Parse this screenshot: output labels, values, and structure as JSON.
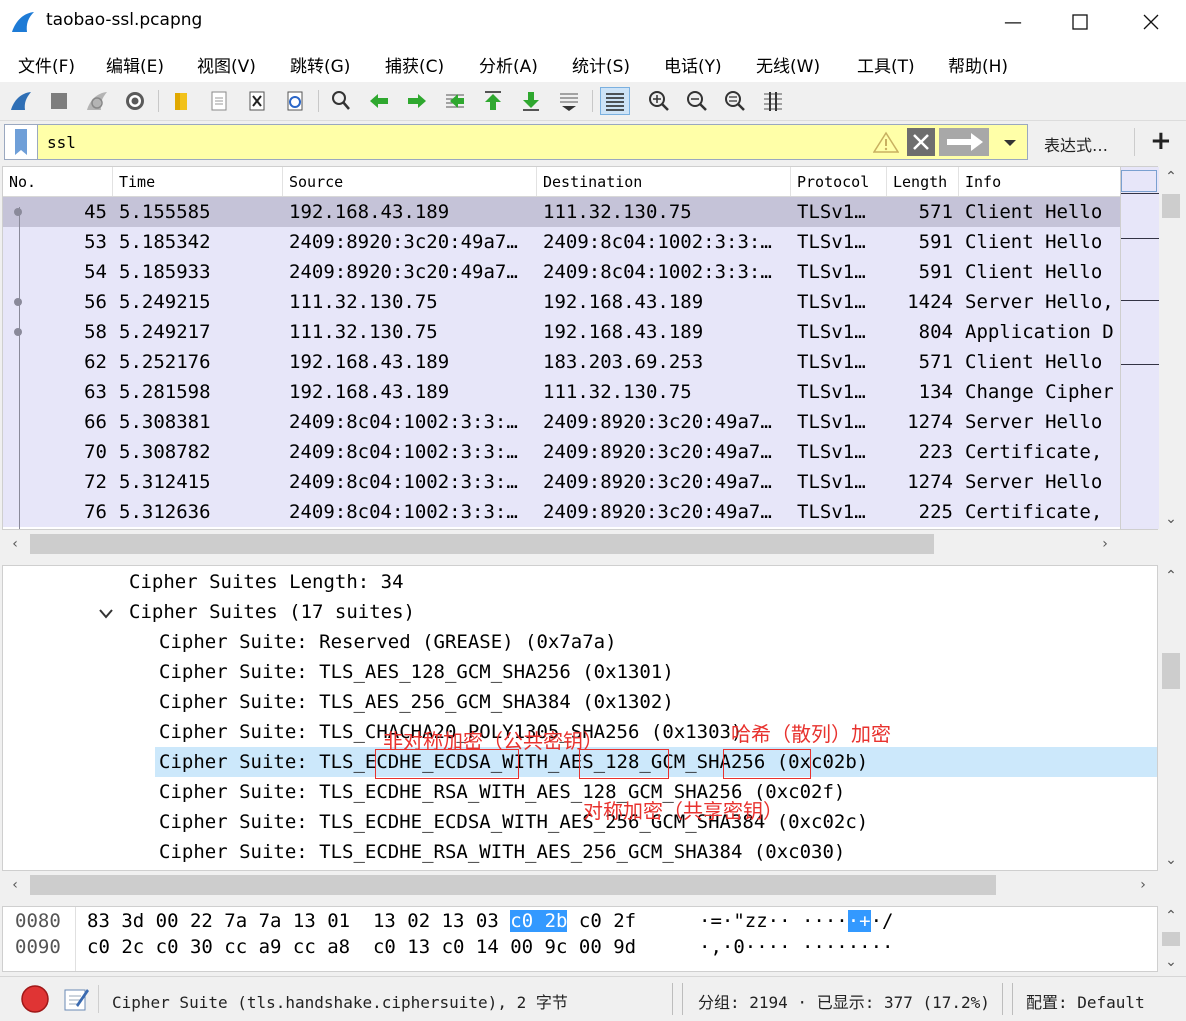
{
  "window": {
    "title": "taobao-ssl.pcapng",
    "min_icon": "minimize-icon",
    "max_icon": "maximize-icon",
    "close_icon": "close-icon"
  },
  "menu": [
    "文件(F)",
    "编辑(E)",
    "视图(V)",
    "跳转(G)",
    "捕获(C)",
    "分析(A)",
    "统计(S)",
    "电话(Y)",
    "无线(W)",
    "工具(T)",
    "帮助(H)"
  ],
  "filter": {
    "value": "ssl",
    "expression_label": "表达式…",
    "add_label": "+"
  },
  "packet_list": {
    "columns": [
      "No.",
      "Time",
      "Source",
      "Destination",
      "Protocol",
      "Length",
      "Info"
    ],
    "rows": [
      {
        "no": "45",
        "time": "5.155585",
        "src": "192.168.43.189",
        "dst": "111.32.130.75",
        "proto": "TLSv1…",
        "len": "571",
        "info": "Client Hello"
      },
      {
        "no": "53",
        "time": "5.185342",
        "src": "2409:8920:3c20:49a7…",
        "dst": "2409:8c04:1002:3:3:…",
        "proto": "TLSv1…",
        "len": "591",
        "info": "Client Hello"
      },
      {
        "no": "54",
        "time": "5.185933",
        "src": "2409:8920:3c20:49a7…",
        "dst": "2409:8c04:1002:3:3:…",
        "proto": "TLSv1…",
        "len": "591",
        "info": "Client Hello"
      },
      {
        "no": "56",
        "time": "5.249215",
        "src": "111.32.130.75",
        "dst": "192.168.43.189",
        "proto": "TLSv1…",
        "len": "1424",
        "info": "Server Hello,"
      },
      {
        "no": "58",
        "time": "5.249217",
        "src": "111.32.130.75",
        "dst": "192.168.43.189",
        "proto": "TLSv1…",
        "len": "804",
        "info": "Application D"
      },
      {
        "no": "62",
        "time": "5.252176",
        "src": "192.168.43.189",
        "dst": "183.203.69.253",
        "proto": "TLSv1…",
        "len": "571",
        "info": "Client Hello"
      },
      {
        "no": "63",
        "time": "5.281598",
        "src": "192.168.43.189",
        "dst": "111.32.130.75",
        "proto": "TLSv1…",
        "len": "134",
        "info": "Change Cipher"
      },
      {
        "no": "66",
        "time": "5.308381",
        "src": "2409:8c04:1002:3:3:…",
        "dst": "2409:8920:3c20:49a7…",
        "proto": "TLSv1…",
        "len": "1274",
        "info": "Server Hello"
      },
      {
        "no": "70",
        "time": "5.308782",
        "src": "2409:8c04:1002:3:3:…",
        "dst": "2409:8920:3c20:49a7…",
        "proto": "TLSv1…",
        "len": "223",
        "info": "Certificate,"
      },
      {
        "no": "72",
        "time": "5.312415",
        "src": "2409:8c04:1002:3:3:…",
        "dst": "2409:8920:3c20:49a7…",
        "proto": "TLSv1…",
        "len": "1274",
        "info": "Server Hello"
      },
      {
        "no": "76",
        "time": "5.312636",
        "src": "2409:8c04:1002:3:3:…",
        "dst": "2409:8920:3c20:49a7…",
        "proto": "TLSv1…",
        "len": "225",
        "info": "Certificate,"
      }
    ]
  },
  "details": {
    "lines": [
      "Cipher Suites Length: 34",
      "Cipher Suites (17 suites)",
      "Cipher Suite: Reserved (GREASE) (0x7a7a)",
      "Cipher Suite: TLS_AES_128_GCM_SHA256 (0x1301)",
      "Cipher Suite: TLS_AES_256_GCM_SHA384 (0x1302)",
      "Cipher Suite: TLS_CHACHA20_POLY1305_SHA256 (0x1303)",
      "Cipher Suite: TLS_ECDHE_ECDSA_WITH_AES_128_GCM_SHA256 (0xc02b)",
      "Cipher Suite: TLS_ECDHE_RSA_WITH_AES_128_GCM_SHA256 (0xc02f)",
      "Cipher Suite: TLS_ECDHE_ECDSA_WITH_AES_256_GCM_SHA384 (0xc02c)",
      "Cipher Suite: TLS_ECDHE_RSA_WITH_AES_256_GCM_SHA384 (0xc030)"
    ],
    "annotations": {
      "asymmetric": "非对称加密（公共密钥）",
      "hash": "哈希（散列）加密",
      "symmetric": "对称加密（共享密钥）"
    }
  },
  "bytes": {
    "rows": [
      {
        "offset": "0080",
        "hex_a": "83 3d 00 22 7a 7a 13 01  13 02 13 03 ",
        "hex_sel": "c0 2b",
        "hex_b": " c0 2f",
        "ascii_a": "·=·\"zz·· ····",
        "ascii_sel": "·+",
        "ascii_b": "·/"
      },
      {
        "offset": "0090",
        "hex_a": "c0 2c c0 30 cc a9 cc a8  c0 13 c0 14 00 9c 00 9d",
        "hex_sel": "",
        "hex_b": "",
        "ascii_a": "·,·0···· ········",
        "ascii_sel": "",
        "ascii_b": ""
      }
    ]
  },
  "status": {
    "field_text": "Cipher Suite (tls.handshake.ciphersuite), 2 字节",
    "packets_text": "分组: 2194 · 已显示: 377 (17.2%)",
    "profile_text": "配置: Default"
  },
  "colors": {
    "row_bg": "#e7e6f9",
    "row_selected": "#c5c3d8",
    "filter_bg": "#ffffa8",
    "highlight": "#cce8fb",
    "annotation": "#e8322e",
    "byte_select": "#3399ff"
  }
}
